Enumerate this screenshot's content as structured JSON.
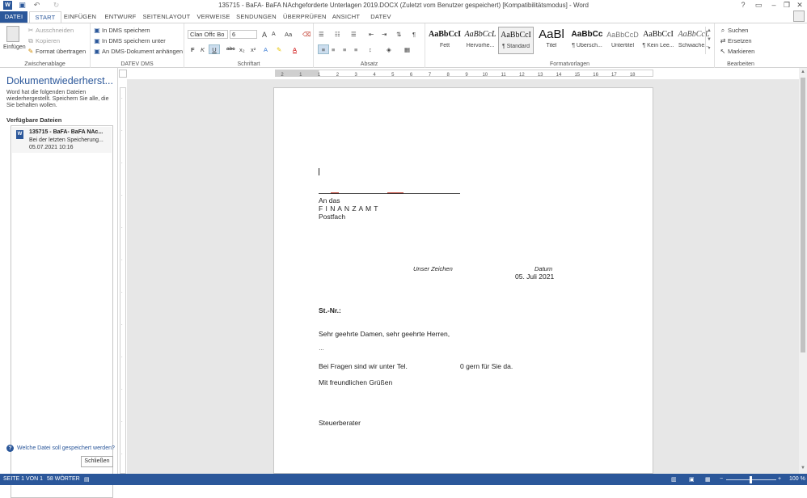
{
  "title": "135715 - BaFA- BaFA NAchgeforderte Unterlagen 2019.DOCX (Zuletzt vom Benutzer gespeichert) [Kompatibilitätsmodus] - Word",
  "quick_access": {
    "word_icon": "word-logo-icon",
    "save": "save-icon",
    "undo": "undo-icon",
    "redo": "redo-icon"
  },
  "window": {
    "help": "?",
    "ribbon_opts": "▭",
    "minimize": "–",
    "restore": "❐",
    "close": "✕"
  },
  "tabs": [
    "DATEI",
    "START",
    "EINFÜGEN",
    "ENTWURF",
    "SEITENLAYOUT",
    "VERWEISE",
    "SENDUNGEN",
    "ÜBERPRÜFEN",
    "ANSICHT",
    "DATEV"
  ],
  "ribbon": {
    "clipboard": {
      "label": "Zwischenablage",
      "paste": "Einfügen",
      "cut": "Ausschneiden",
      "copy": "Kopieren",
      "format_painter": "Format übertragen"
    },
    "datev": {
      "label": "DATEV DMS",
      "save_dms": "In DMS speichern",
      "save_dms_as": "In DMS speichern unter",
      "attach": "An DMS-Dokument anhängen"
    },
    "font": {
      "label": "Schriftart",
      "family": "Clan Offc Bo",
      "size": "6",
      "bold": "F",
      "italic": "K",
      "underline": "U",
      "strike": "abc",
      "sub": "x₂",
      "sup": "x²",
      "case": "Aa",
      "grow": "A",
      "shrink": "A"
    },
    "paragraph": {
      "label": "Absatz",
      "pilcrow": "¶"
    },
    "styles": {
      "label": "Formatvorlagen",
      "items": [
        {
          "preview": "AaBbCcI",
          "name": "Fett"
        },
        {
          "preview": "AaBbCcL",
          "name": "Hervorhe..."
        },
        {
          "preview": "AaBbCcI",
          "name": "¶ Standard"
        },
        {
          "preview": "AaBl",
          "name": "Titel"
        },
        {
          "preview": "AaBbCc",
          "name": "¶ Übersch..."
        },
        {
          "preview": "AaBbCcD",
          "name": "Untertitel"
        },
        {
          "preview": "AaBbCcI",
          "name": "¶ Kein Lee..."
        },
        {
          "preview": "AaBbCcL",
          "name": "Schwache..."
        }
      ]
    },
    "editing": {
      "label": "Bearbeiten",
      "find": "Suchen",
      "replace": "Ersetzen",
      "select": "Markieren"
    }
  },
  "recovery": {
    "heading": "Dokumentwiederherst...",
    "description": "Word hat die folgenden Dateien wiederhergestellt. Speichern Sie alle, die Sie behalten wollen.",
    "available_label": "Verfügbare Dateien",
    "file": {
      "name": "135715 - BaFA- BaFA NAc...",
      "status": "Bei der letzten Speicherung...",
      "date": "05.07.2021 10:16"
    },
    "help_link": "Welche Datei soll gespeichert werden?",
    "close_button": "Schließen"
  },
  "ruler": {
    "marks": [
      "2",
      "1",
      "1",
      "2",
      "3",
      "4",
      "5",
      "6",
      "7",
      "8",
      "9",
      "10",
      "11",
      "12",
      "13",
      "14",
      "15",
      "16",
      "17",
      "18"
    ]
  },
  "document": {
    "recipient_line1": "An das",
    "recipient_line2": "F I N A N Z A M T",
    "recipient_line3": "Postfach",
    "ref_label": "Unser Zeichen",
    "date_label": "Datum",
    "date_value": "05. Juli 2021",
    "taxno": "St.-Nr.:",
    "salutation": "Sehr geehrte Damen, sehr geehrte Herren,",
    "ellipsis": "…",
    "questions": "Bei Fragen sind wir unter Tel.",
    "questions_end": "0 gern für Sie da.",
    "closing": "Mit freundlichen Grüßen",
    "signature": "Steuerberater"
  },
  "status": {
    "page": "SEITE 1 VON 1",
    "words": "58 WÖRTER",
    "zoom": "100 %"
  }
}
